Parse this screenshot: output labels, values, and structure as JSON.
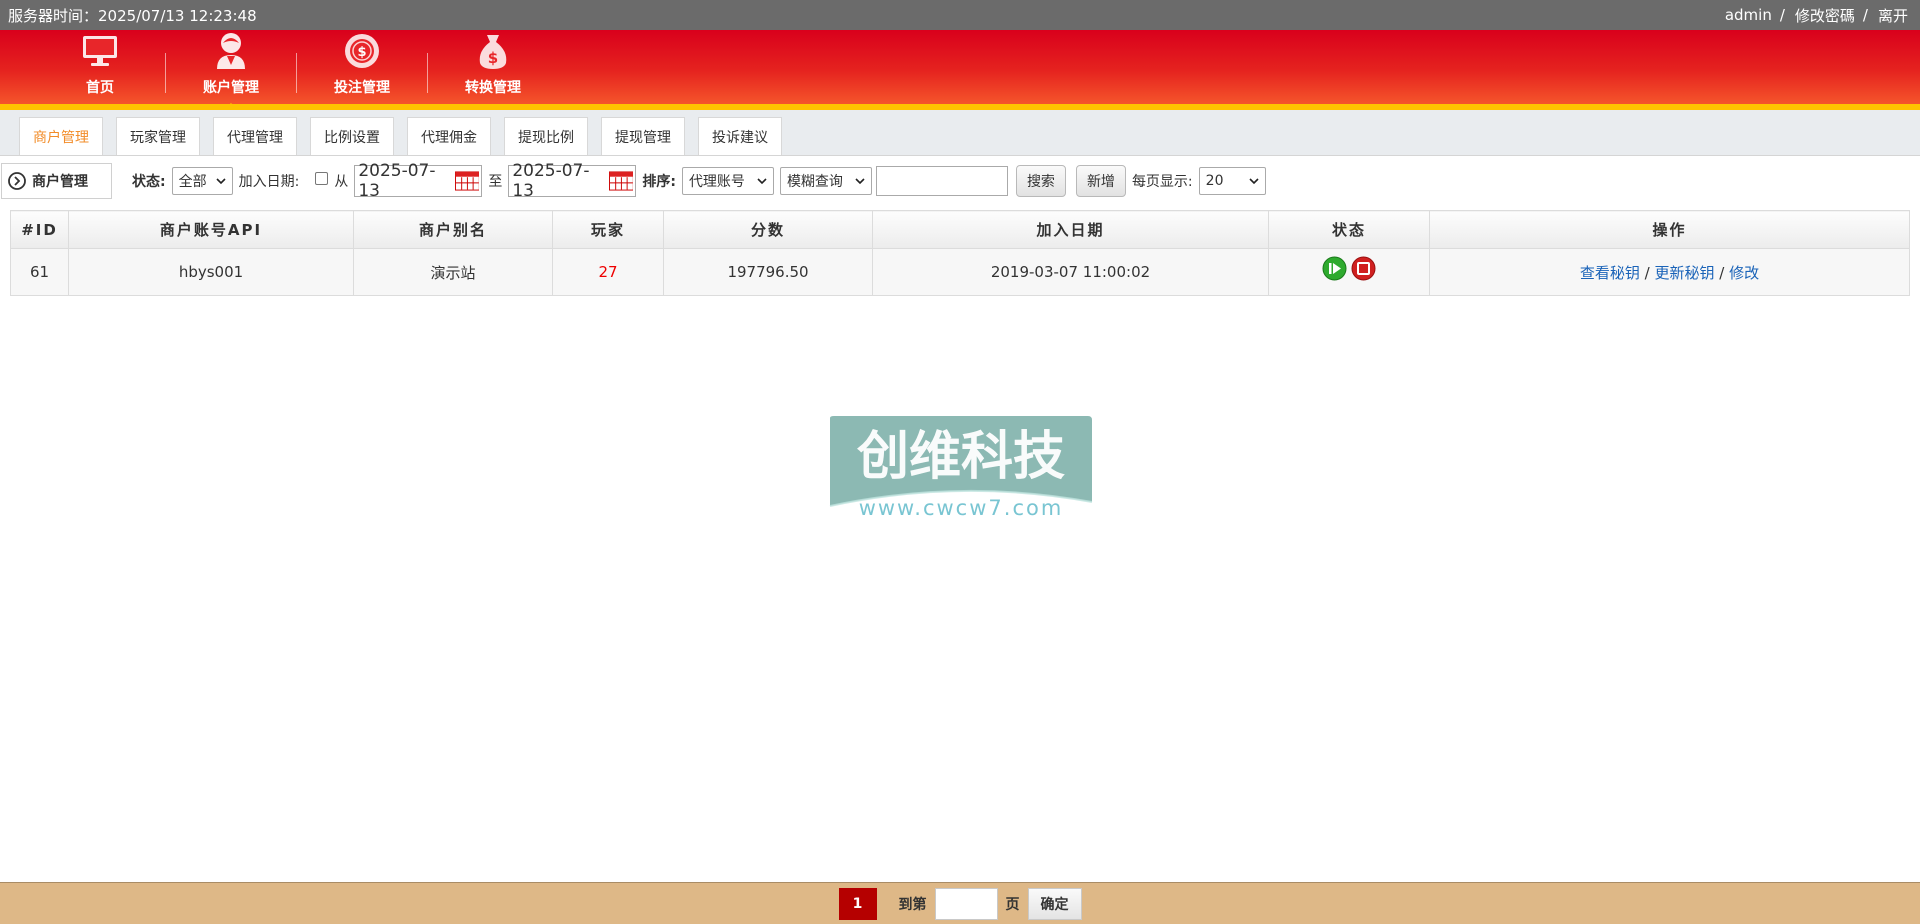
{
  "topbar": {
    "server_time_label": "服务器时间：",
    "server_time": "2025/07/13 12:23:48",
    "user": "admin",
    "sep": "/",
    "change_password": "修改密碼",
    "logout": "离开"
  },
  "nav": {
    "items": [
      {
        "label": "首页",
        "icon": "monitor-icon"
      },
      {
        "label": "账户管理",
        "icon": "user-icon"
      },
      {
        "label": "投注管理",
        "icon": "chip-icon"
      },
      {
        "label": "转换管理",
        "icon": "money-bag-icon"
      }
    ]
  },
  "subtabs": [
    "商户管理",
    "玩家管理",
    "代理管理",
    "比例设置",
    "代理佣金",
    "提现比例",
    "提现管理",
    "投诉建议"
  ],
  "filter": {
    "crumb": "商户管理",
    "status_label": "状态:",
    "status_value": "全部",
    "join_date_label": "加入日期:",
    "from_label": "从",
    "date_from": "2025-07-13",
    "to_label": "至",
    "date_to": "2025-07-13",
    "sort_label": "排序:",
    "sort_value": "代理账号",
    "query_mode": "模糊查询",
    "search_btn": "搜索",
    "add_btn": "新增",
    "per_page_label": "每页显示:",
    "per_page_value": "20"
  },
  "table": {
    "headers": [
      "#ID",
      "商户账号API",
      "商户别名",
      "玩家",
      "分数",
      "加入日期",
      "状态",
      "操作"
    ],
    "rows": [
      {
        "id": "61",
        "api": "hbys001",
        "alias": "演示站",
        "players": "27",
        "score": "197796.50",
        "date": "2019-03-07 11:00:02",
        "actions": {
          "view_key": "查看秘钥",
          "sep": "/",
          "renew_key": "更新秘钥",
          "edit": "修改"
        }
      }
    ]
  },
  "watermark": {
    "title": "创维科技",
    "url": "www.cwcw7.com"
  },
  "pager": {
    "current": "1",
    "goto_label": "到第",
    "page_label": "页",
    "confirm": "确定"
  },
  "colors": {
    "nav_red": "#e5231f",
    "accent_yellow": "#ffc400",
    "pager_bg": "#deb887",
    "active_tab": "#f28c28",
    "link": "#1a63b8"
  }
}
